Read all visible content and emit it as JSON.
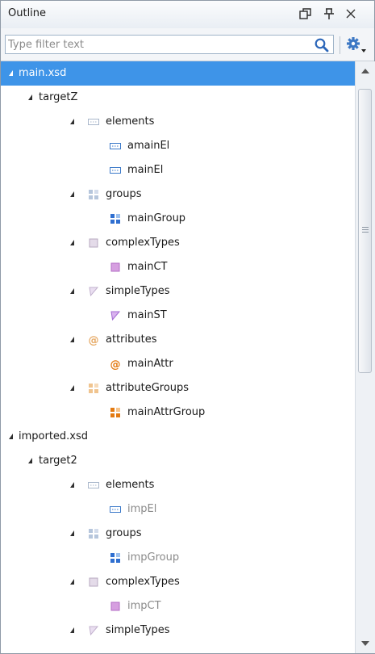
{
  "panel": {
    "title": "Outline"
  },
  "filter": {
    "placeholder": "Type filter text"
  },
  "tree": {
    "rows": [
      {
        "label": "main.xsd",
        "level": 0,
        "icon": "none",
        "selected": true,
        "dim": false
      },
      {
        "label": "targetZ",
        "level": 1,
        "icon": "none",
        "selected": false,
        "dim": false
      },
      {
        "label": "elements",
        "level": 2,
        "icon": "element-group",
        "selected": false,
        "dim": false
      },
      {
        "label": "amainEl",
        "level": 3,
        "icon": "element",
        "selected": false,
        "dim": false
      },
      {
        "label": "mainEl",
        "level": 3,
        "icon": "element",
        "selected": false,
        "dim": false
      },
      {
        "label": "groups",
        "level": 2,
        "icon": "groups-group",
        "selected": false,
        "dim": false
      },
      {
        "label": "mainGroup",
        "level": 3,
        "icon": "group",
        "selected": false,
        "dim": false
      },
      {
        "label": "complexTypes",
        "level": 2,
        "icon": "complex-group",
        "selected": false,
        "dim": false
      },
      {
        "label": "mainCT",
        "level": 3,
        "icon": "complex",
        "selected": false,
        "dim": false
      },
      {
        "label": "simpleTypes",
        "level": 2,
        "icon": "simple-group",
        "selected": false,
        "dim": false
      },
      {
        "label": "mainST",
        "level": 3,
        "icon": "simple",
        "selected": false,
        "dim": false
      },
      {
        "label": "attributes",
        "level": 2,
        "icon": "attribute-group",
        "selected": false,
        "dim": false
      },
      {
        "label": "mainAttr",
        "level": 3,
        "icon": "attribute",
        "selected": false,
        "dim": false
      },
      {
        "label": "attributeGroups",
        "level": 2,
        "icon": "attrgroups-group",
        "selected": false,
        "dim": false
      },
      {
        "label": "mainAttrGroup",
        "level": 3,
        "icon": "attrgroup",
        "selected": false,
        "dim": false
      },
      {
        "label": "imported.xsd",
        "level": 0,
        "icon": "none",
        "selected": false,
        "dim": false
      },
      {
        "label": "target2",
        "level": 1,
        "icon": "none",
        "selected": false,
        "dim": false
      },
      {
        "label": "elements",
        "level": 2,
        "icon": "element-group",
        "selected": false,
        "dim": false
      },
      {
        "label": "impEl",
        "level": 3,
        "icon": "element",
        "selected": false,
        "dim": true
      },
      {
        "label": "groups",
        "level": 2,
        "icon": "groups-group",
        "selected": false,
        "dim": false
      },
      {
        "label": "impGroup",
        "level": 3,
        "icon": "group",
        "selected": false,
        "dim": true
      },
      {
        "label": "complexTypes",
        "level": 2,
        "icon": "complex-group",
        "selected": false,
        "dim": false
      },
      {
        "label": "impCT",
        "level": 3,
        "icon": "complex",
        "selected": false,
        "dim": true
      },
      {
        "label": "simpleTypes",
        "level": 2,
        "icon": "simple-group",
        "selected": false,
        "dim": false
      }
    ]
  },
  "colors": {
    "selection": "#3e94e8",
    "element": "#3b79c9",
    "group": "#2f6fd0",
    "complex": "#b36ec6",
    "simple": "#a36bd2",
    "attribute": "#e37a12"
  }
}
